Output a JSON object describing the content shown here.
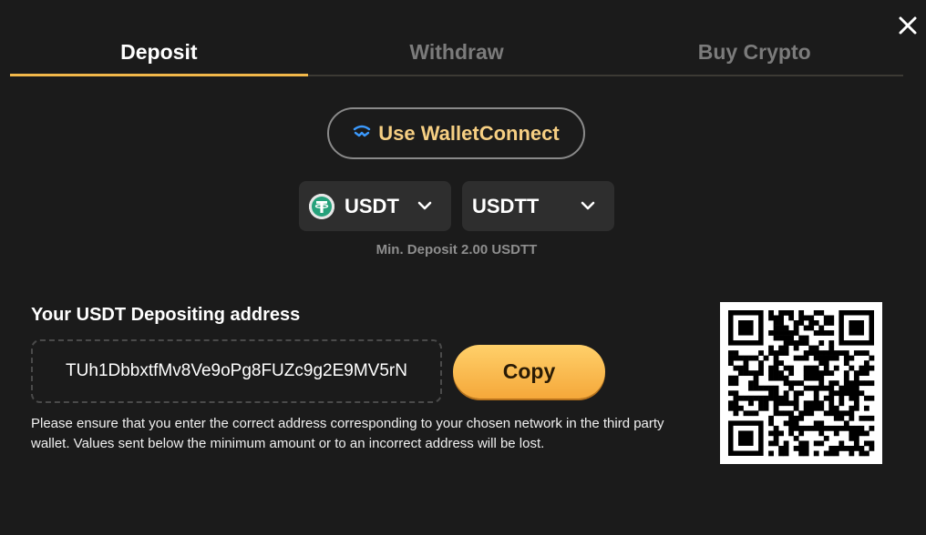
{
  "tabs": [
    {
      "label": "Deposit",
      "active": true
    },
    {
      "label": "Withdraw",
      "active": false
    },
    {
      "label": "Buy Crypto",
      "active": false
    }
  ],
  "close_icon": "close-icon",
  "walletconnect": {
    "label": "Use WalletConnect",
    "icon": "walletconnect-icon",
    "color": "#f6cf83"
  },
  "coin_select": {
    "value": "USDT",
    "icon": "tether-icon"
  },
  "network_select": {
    "value": "USDTT"
  },
  "min_deposit": "Min. Deposit 2.00 USDTT",
  "address_section": {
    "title": "Your USDT Depositing address",
    "address": "TUh1DbbxtfMv8Ve9oPg8FUZc9g2E9MV5rN",
    "copy_label": "Copy",
    "note": "Please ensure that you enter the correct address corresponding to your chosen network in the third party wallet. Values sent below the minimum amount or to an incorrect address will be lost."
  },
  "colors": {
    "background": "#1b1b1b",
    "accent": "#f2b84a",
    "tether": "#26a17b"
  }
}
